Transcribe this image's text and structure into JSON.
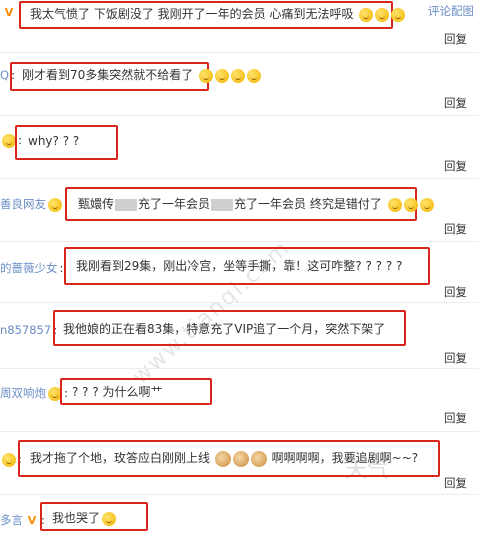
{
  "reply_label": "回复",
  "config_link": "评论配图",
  "watermark": "www.tianqi.com",
  "watermark_cn": "天气",
  "comments": [
    {
      "user": "V",
      "text": "我太气愤了 下饭剧没了 我刚开了一年的会员 心痛到无法呼吸"
    },
    {
      "user": "Q",
      "text": "刚才看到70多集突然就不给看了"
    },
    {
      "user": "",
      "text": "why? ? ?"
    },
    {
      "user": "善良网友",
      "text_a": "甄嬛传",
      "text_b": "充了一年会员",
      "text_c": "充了一年会员 终究是错付了"
    },
    {
      "user": "的蔷薇少女",
      "text": "我刚看到29集，刚出冷宫，坐等手撕，靠！这可咋整? ? ? ? ?"
    },
    {
      "user": "n857857",
      "text": "我他娘的正在看83集，特意充了VIP追了一个月，突然下架了"
    },
    {
      "user": "周双响炮",
      "text": "? ? ? 为什么啊艹"
    },
    {
      "user": "",
      "text_a": "我才拖了个地，玫答应白刚刚上线",
      "text_b": "啊啊啊啊，我要追剧啊~~?"
    },
    {
      "user": "多言",
      "text": "我也哭了"
    }
  ]
}
